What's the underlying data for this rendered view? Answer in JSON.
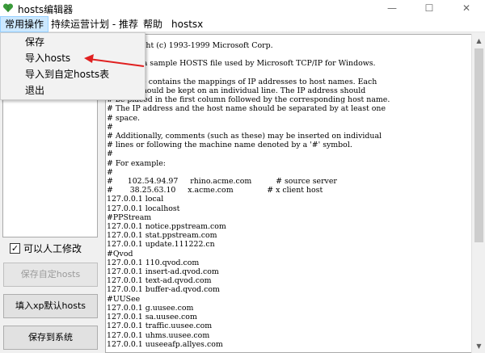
{
  "window": {
    "title": "hosts编辑器",
    "minimize": "—",
    "maximize": "☐",
    "close": "✕"
  },
  "menu": {
    "items": [
      "常用操作",
      "持续运营计划 - 推荐",
      "帮助",
      "hostsx"
    ],
    "dropdown": [
      "保存",
      "导入hosts",
      "导入到自定hosts表",
      "退出"
    ]
  },
  "sidebar": {
    "checkbox_label": "可以人工修改",
    "checkbox_checked": true,
    "check_mark": "✓",
    "buttons": {
      "save_custom": "保存自定hosts",
      "import_xp": "填入xp默认hosts",
      "save_system": "保存到系统"
    }
  },
  "editor": {
    "lines": [
      "# Copyright (c) 1993-1999 Microsoft Corp.",
      "#",
      "# This is a sample HOSTS file used by Microsoft TCP/IP for Windows.",
      "#",
      "# This file contains the mappings of IP addresses to host names. Each",
      "# entry should be kept on an individual line. The IP address should",
      "# be placed in the first column followed by the corresponding host name.",
      "# The IP address and the host name should be separated by at least one",
      "# space.",
      "#",
      "# Additionally, comments (such as these) may be inserted on individual",
      "# lines or following the machine name denoted by a '#' symbol.",
      "#",
      "# For example:",
      "#",
      "#      102.54.94.97     rhino.acme.com          # source server",
      "#       38.25.63.10     x.acme.com              # x client host",
      "127.0.0.1 local",
      "127.0.0.1 localhost",
      "#PPStream",
      "127.0.0.1 notice.ppstream.com",
      "127.0.0.1 stat.ppstream.com",
      "127.0.0.1 update.111222.cn",
      "#Qvod",
      "127.0.0.1 110.qvod.com",
      "127.0.0.1 insert-ad.qvod.com",
      "127.0.0.1 text-ad.qvod.com",
      "127.0.0.1 buffer-ad.qvod.com",
      "#UUSee",
      "127.0.0.1 g.uusee.com",
      "127.0.0.1 sa.uusee.com",
      "127.0.0.1 traffic.uusee.com",
      "127.0.0.1 uhms.uusee.com",
      "127.0.0.1 uuseeafp.allyes.com"
    ]
  },
  "colors": {
    "arrow": "#e02020",
    "icon_green": "#3a9a3a"
  }
}
